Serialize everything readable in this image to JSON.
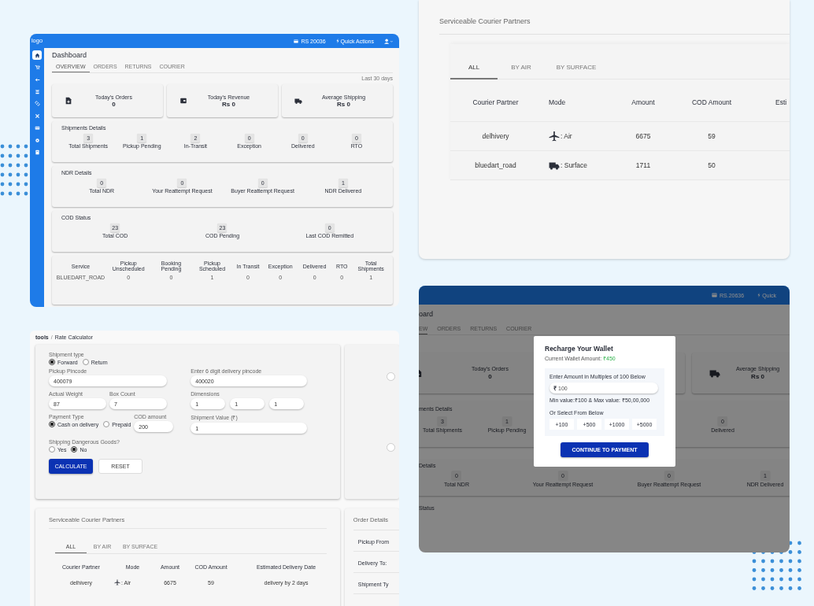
{
  "dashboard": {
    "logo": "logo",
    "wallet_balance": "RS 20036",
    "quick_actions": "Quick Actions",
    "sidebar": [
      {
        "selected": true
      },
      {
        "selected": false
      },
      {
        "selected": false
      },
      {
        "selected": false
      },
      {
        "selected": false
      },
      {
        "selected": false
      },
      {
        "selected": false
      },
      {
        "selected": false
      },
      {
        "selected": false
      }
    ],
    "title": "Dashboard",
    "tabs": [
      {
        "label": "OVERVIEW",
        "selected": true
      },
      {
        "label": "ORDERS",
        "selected": false
      },
      {
        "label": "RETURNS",
        "selected": false
      },
      {
        "label": "COURIER",
        "selected": false
      }
    ],
    "date_range": "Last 30 days",
    "stats": [
      {
        "label": "Today's Orders",
        "value": "0"
      },
      {
        "label": "Today's Revenue",
        "value": "Rs 0"
      },
      {
        "label": "Average Shipping",
        "value": "Rs 0"
      }
    ],
    "sections": [
      {
        "title": "Shipments Details",
        "items": [
          {
            "value": "3",
            "label": "Total Shipments"
          },
          {
            "value": "1",
            "label": "Pickup Pending"
          },
          {
            "value": "2",
            "label": "In-Transit"
          },
          {
            "value": "0",
            "label": "Exception"
          },
          {
            "value": "0",
            "label": "Delivered"
          },
          {
            "value": "0",
            "label": "RTO"
          }
        ]
      },
      {
        "title": "NDR Details",
        "items": [
          {
            "value": "0",
            "label": "Total NDR"
          },
          {
            "value": "0",
            "label": "Your Reattempt Request"
          },
          {
            "value": "0",
            "label": "Buyer Reattempt Request"
          },
          {
            "value": "1",
            "label": "NDR Delivered"
          }
        ]
      },
      {
        "title": "COD Status",
        "items": [
          {
            "value": "23",
            "label": "Total COD"
          },
          {
            "value": "23",
            "label": "COD Pending"
          },
          {
            "value": "0",
            "label": "Last COD Remitted"
          }
        ]
      }
    ],
    "table": {
      "columns": [
        "Service",
        "Pickup Unscheduled",
        "Booking Pending",
        "Pickup Scheduled",
        "In Transit",
        "Exception",
        "Delivered",
        "RTO",
        "Total Shipments"
      ],
      "rows": [
        [
          "BLUEDART_ROAD",
          "0",
          "0",
          "1",
          "0",
          "0",
          "0",
          "0",
          "1"
        ]
      ]
    }
  },
  "courier_partners": {
    "title": "Serviceable Courier Partners",
    "tabs": [
      {
        "label": "ALL",
        "selected": true
      },
      {
        "label": "BY AIR",
        "selected": false
      },
      {
        "label": "BY SURFACE",
        "selected": false
      }
    ],
    "columns": [
      "Courier Partner",
      "Mode",
      "Amount",
      "COD Amount",
      "Esti"
    ],
    "rows": [
      {
        "partner": "delhivery",
        "kind": "air",
        "mode": ": Air",
        "amount": "6675",
        "cod": "59"
      },
      {
        "partner": "bluedart_road",
        "kind": "surface",
        "mode": ": Surface",
        "amount": "1711",
        "cod": "50"
      }
    ]
  },
  "rate_calculator": {
    "breadcrumb": [
      "tools",
      "Rate Calculator"
    ],
    "separator": "/",
    "shipment_type": {
      "label": "Shipment type",
      "options": [
        {
          "label": "Forward",
          "selected": true
        },
        {
          "label": "Return",
          "selected": false
        }
      ]
    },
    "pickup": {
      "label": "Pickup Pincode",
      "value": "400079"
    },
    "delivery": {
      "label": "Enter 6 digit delivery pincode",
      "value": "400020"
    },
    "weight": {
      "label": "Actual Weight",
      "value": "87"
    },
    "box_count": {
      "label": "Box Count",
      "value": "7"
    },
    "dimensions": {
      "label": "Dimensions",
      "values": [
        "1",
        "1",
        "1"
      ]
    },
    "payment": {
      "label": "Payment Type",
      "options": [
        {
          "label": "Cash on delivery",
          "selected": true
        },
        {
          "label": "Prepaid",
          "selected": false
        }
      ]
    },
    "cod_amount": {
      "label": "COD amount",
      "value": "200"
    },
    "shipment_value": {
      "label": "Shipment Value (₹)",
      "value": "1"
    },
    "dangerous": {
      "label": "Shipping Dangerous Goods?",
      "options": [
        {
          "label": "Yes",
          "selected": false
        },
        {
          "label": "No",
          "selected": true
        }
      ]
    },
    "buttons": [
      "CALCULATE",
      "RESET"
    ],
    "partners": {
      "title": "Serviceable Courier Partners",
      "tabs": [
        {
          "label": "ALL",
          "selected": true
        },
        {
          "label": "BY AIR",
          "selected": false
        },
        {
          "label": "BY SURFACE",
          "selected": false
        }
      ],
      "columns": [
        "Courier Partner",
        "Mode",
        "Amount",
        "COD Amount",
        "Estimated Delivery Date"
      ],
      "rows": [
        {
          "partner": "delhivery",
          "kind": "air",
          "mode": ": Air",
          "amount": "6675",
          "cod": "59",
          "eta": "delivery by 2 days"
        }
      ]
    },
    "order_details": {
      "title": "Order Details",
      "rows": [
        "Pickup From",
        "Delivery To:",
        "Shipment Ty"
      ]
    }
  },
  "wallet_screen": {
    "wallet_balance": "RS.20636",
    "quick_actions": "Quick",
    "title": "oard",
    "tabs": [
      {
        "label": "EW",
        "selected": true
      },
      {
        "label": "ORDERS",
        "selected": false
      },
      {
        "label": "RETURNS",
        "selected": false
      },
      {
        "label": "COURIER",
        "selected": false
      }
    ],
    "stats": [
      {
        "label": "Today's Orders",
        "value": "0"
      },
      {
        "label": "Average Shipping",
        "value": "Rs 0"
      }
    ],
    "shipments": {
      "title": "ments Details",
      "items": [
        {
          "value": "3",
          "label": "Total Shipments"
        },
        {
          "value": "1",
          "label": "Pickup Pending"
        },
        {
          "value": "0",
          "label": "Delivered"
        }
      ]
    },
    "ndr": {
      "title": "Details",
      "items": [
        {
          "value": "0",
          "label": "Total NDR"
        },
        {
          "value": "0",
          "label": "Your Reattempt Request"
        },
        {
          "value": "0",
          "label": "Buyer Reattempt Request"
        },
        {
          "value": "1",
          "label": "NDR Delivered"
        }
      ]
    },
    "cod_title": "Status",
    "modal": {
      "title": "Recharge Your Wallet",
      "balance_label": "Current Wallet Amount:",
      "balance": "₹450",
      "prompt": "Enter Amount in Multiples of 100 Below",
      "currency": "₹",
      "amount": "100",
      "limits": "Min value:₹100 & Max value: ₹50,00,000",
      "choose": "Or Select From Below",
      "chips": [
        "+100",
        "+500",
        "+1000",
        "+5000"
      ],
      "button": "CONTINUE TO PAYMENT"
    }
  }
}
